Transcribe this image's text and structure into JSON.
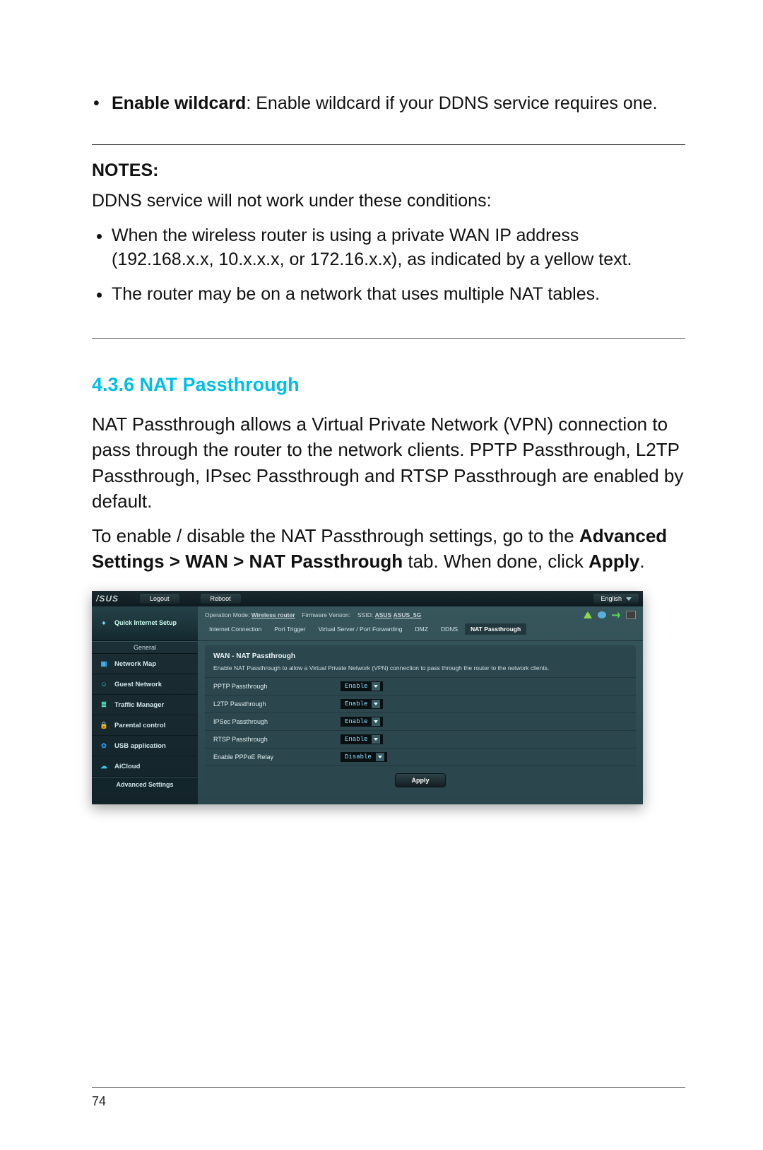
{
  "doc": {
    "bullet_strong": "Enable wildcard",
    "bullet_rest": ": Enable wildcard if your DDNS service requires one.",
    "notes_label": "NOTES",
    "notes_intro": "DDNS service will not work under these conditions:",
    "notes_items": [
      "When the wireless router is using a private WAN IP address (192.168.x.x, 10.x.x.x, or 172.16.x.x), as indicated by a yellow text.",
      "The router may be on a network that uses multiple NAT tables."
    ],
    "section_heading": "4.3.6 NAT Passthrough",
    "para1": "NAT Passthrough allows a Virtual Private Network (VPN) connection to pass through the router to the network clients. PPTP Passthrough, L2TP Passthrough, IPsec Passthrough and RTSP Passthrough are enabled by default.",
    "para2_pre": "To enable / disable the NAT Passthrough settings, go to the ",
    "para2_bold": "Advanced Settings > WAN > NAT Passthrough",
    "para2_mid": " tab. When done, click ",
    "para2_bold2": "Apply",
    "para2_end": ".",
    "page_number": "74"
  },
  "shot": {
    "logo": "/SUS",
    "topbar": {
      "logout": "Logout",
      "reboot": "Reboot",
      "language": "English"
    },
    "info": {
      "op_mode_label": "Operation Mode:",
      "op_mode_value": "Wireless router",
      "fw_label": "Firmware Version:",
      "ssid_label": "SSID:",
      "ssid1": "ASUS",
      "ssid2": "ASUS_5G"
    },
    "tabs": [
      "Internet Connection",
      "Port Trigger",
      "Virtual Server / Port Forwarding",
      "DMZ",
      "DDNS",
      "NAT Passthrough"
    ],
    "active_tab": "NAT Passthrough",
    "sidebar": {
      "quick": "Quick Internet Setup",
      "general_label": "General",
      "items": [
        {
          "label": "Network Map",
          "color": "#3fb7ff"
        },
        {
          "label": "Guest Network",
          "color": "#2fc8e6"
        },
        {
          "label": "Traffic Manager",
          "color": "#55e0c2"
        },
        {
          "label": "Parental control",
          "color": "#39e0f0"
        },
        {
          "label": "USB application",
          "color": "#2f8fe6"
        },
        {
          "label": "AiCloud",
          "color": "#3fc7e6"
        }
      ],
      "advanced_label": "Advanced Settings"
    },
    "panel": {
      "title": "WAN - NAT Passthrough",
      "desc": "Enable NAT Passthrough to allow a Virtual Private Network (VPN) connection to pass through the router to the network clients.",
      "rows": [
        {
          "label": "PPTP Passthrough",
          "value": "Enable"
        },
        {
          "label": "L2TP Passthrough",
          "value": "Enable"
        },
        {
          "label": "IPSec Passthrough",
          "value": "Enable"
        },
        {
          "label": "RTSP Passthrough",
          "value": "Enable"
        },
        {
          "label": "Enable PPPoE Relay",
          "value": "Disable"
        }
      ],
      "apply": "Apply"
    }
  }
}
